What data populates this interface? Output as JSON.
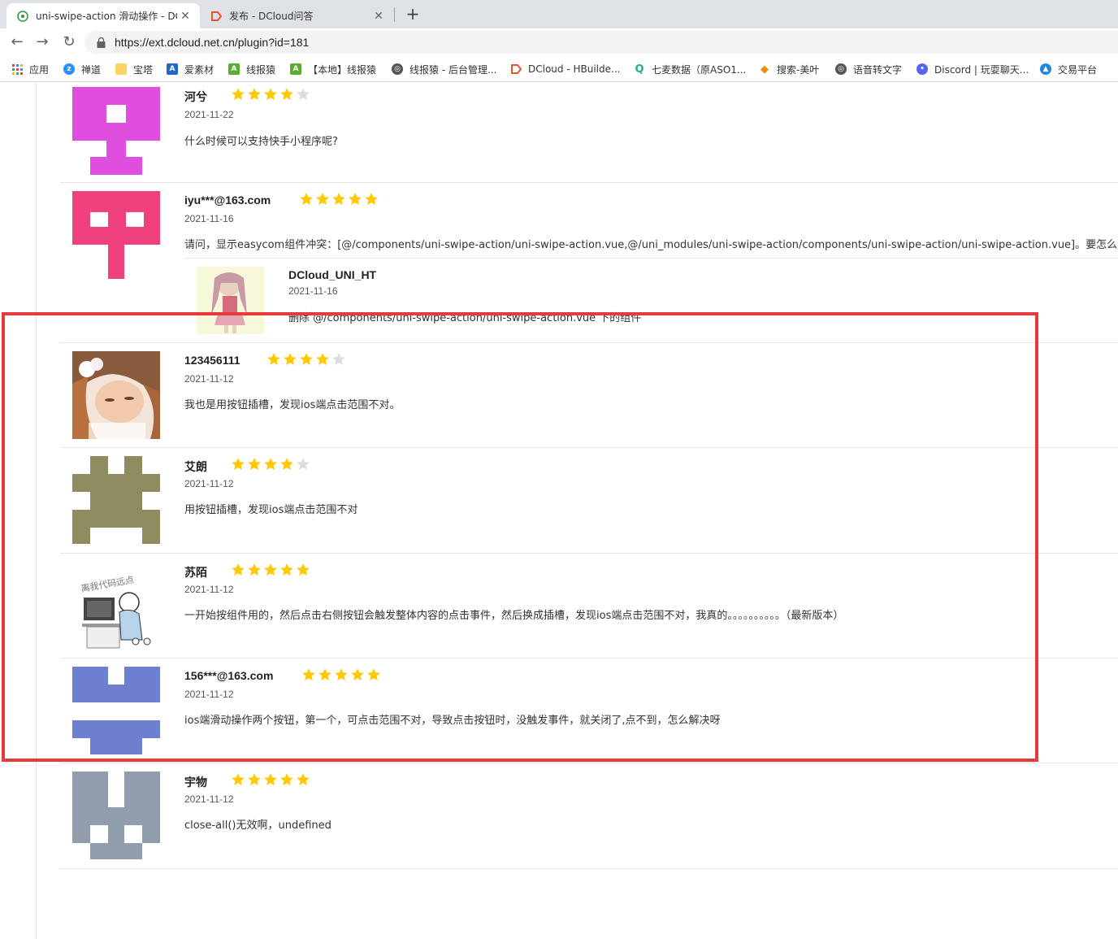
{
  "browser": {
    "tabs": [
      {
        "title": "uni-swipe-action 滑动操作 - DC",
        "active": true
      },
      {
        "title": "发布 - DCloud问答",
        "active": false
      }
    ],
    "new_tab": "+",
    "url": "https://ext.dcloud.net.cn/plugin?id=181",
    "bookmarks": [
      {
        "label": "应用",
        "icon": "apps-grid-icon"
      },
      {
        "label": "禅道",
        "icon": "chandao-icon"
      },
      {
        "label": "宝塔",
        "icon": "folder-icon"
      },
      {
        "label": "爱素材",
        "icon": "aisucai-icon"
      },
      {
        "label": "线报猿",
        "icon": "api-icon"
      },
      {
        "label": "【本地】线报猿",
        "icon": "api-icon"
      },
      {
        "label": "线报猿 - 后台管理...",
        "icon": "globe-icon"
      },
      {
        "label": "DCloud - HBuilde...",
        "icon": "dcloud-icon"
      },
      {
        "label": "七麦数据（原ASO1...",
        "icon": "qimai-icon"
      },
      {
        "label": "搜索-美叶",
        "icon": "diamond-icon"
      },
      {
        "label": "语音转文字",
        "icon": "globe-icon"
      },
      {
        "label": "Discord | 玩耍聊天...",
        "icon": "discord-icon"
      },
      {
        "label": "交易平台",
        "icon": "trade-icon"
      }
    ]
  },
  "reviews": [
    {
      "name": "河兮",
      "rating": 4,
      "date": "2021-11-22",
      "text": "什么时候可以支持快手小程序呢?",
      "avatar_color": "#e04ee0"
    },
    {
      "name": "iyu***@163.com",
      "rating": 5,
      "date": "2021-11-16",
      "text": "请问，显示easycom组件冲突：[@/components/uni-swipe-action/uni-swipe-action.vue,@/uni_modules/uni-swipe-action/components/uni-swipe-action/uni-swipe-action.vue]。要怎么解决",
      "avatar_color": "#f0407e",
      "reply": {
        "name": "DCloud_UNI_HT",
        "date": "2021-11-16",
        "text": "删除 @/components/uni-swipe-action/uni-swipe-action.vue 下的组件"
      }
    },
    {
      "name": "123456111",
      "rating": 4,
      "date": "2021-11-12",
      "text": "我也是用按钮插槽，发现ios端点击范围不对。",
      "avatar_color": "#c08870"
    },
    {
      "name": "艾朗",
      "rating": 4,
      "date": "2021-11-12",
      "text": "用按钮插槽，发现ios端点击范围不对",
      "avatar_color": "#8e8c5e"
    },
    {
      "name": "苏陌",
      "rating": 5,
      "date": "2021-11-12",
      "text": "一开始按组件用的，然后点击右侧按钮会触发整体内容的点击事件，然后换成插槽，发现ios端点击范围不对，我真的。。。。。。。。。。（最新版本）",
      "avatar_color": "#ffffff",
      "avatar_caption": "离我代码远点"
    },
    {
      "name": "156***@163.com",
      "rating": 5,
      "date": "2021-11-12",
      "text": "ios端滑动操作两个按钮，第一个，可点击范围不对，导致点击按钮时，没触发事件，就关闭了,点不到，怎么解决呀",
      "avatar_color": "#6f7fd0"
    },
    {
      "name": "宇物",
      "rating": 5,
      "date": "2021-11-12",
      "text": "close-all()无效啊，undefined",
      "avatar_color": "#909dad"
    }
  ],
  "colors": {
    "star_on": "#ffc800",
    "star_off": "#dddddd",
    "highlight_box": "#e9393c"
  }
}
